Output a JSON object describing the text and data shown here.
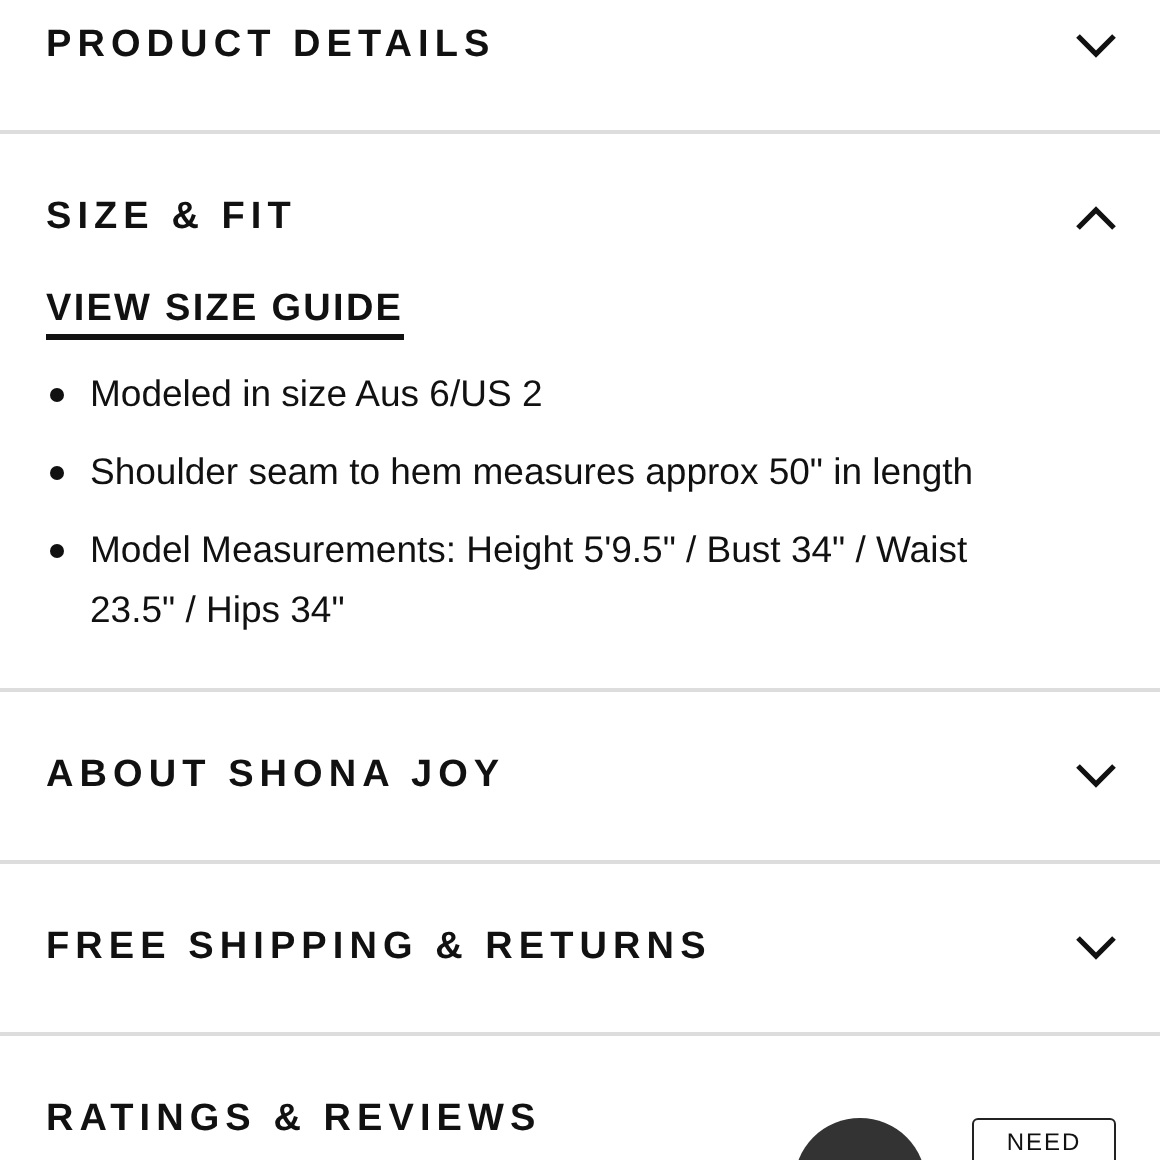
{
  "sections": [
    {
      "title": "PRODUCT DETAILS",
      "expanded": false
    },
    {
      "title": "SIZE & FIT",
      "expanded": true,
      "link": "VIEW SIZE GUIDE",
      "bullets": [
        "Modeled in size Aus 6/US 2",
        "Shoulder seam to hem measures approx 50\" in length",
        "Model Measurements: Height 5'9.5\" / Bust 34\" / Waist 23.5\" / Hips 34\""
      ]
    },
    {
      "title": "ABOUT SHONA JOY",
      "expanded": false
    },
    {
      "title": "FREE SHIPPING & RETURNS",
      "expanded": false
    },
    {
      "title": "RATINGS & REVIEWS"
    }
  ],
  "help_button": {
    "label": "NEED"
  }
}
